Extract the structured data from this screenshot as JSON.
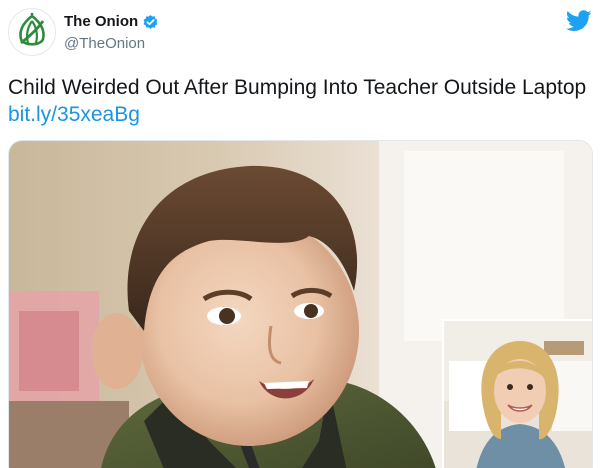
{
  "tweet": {
    "account": {
      "display_name": "The Onion",
      "handle": "@TheOnion",
      "verified": true,
      "avatar_icon": "onion-logo-icon"
    },
    "platform_icon": "twitter-bird-icon",
    "text": "Child Weirded Out After Bumping Into Teacher Outside Laptop",
    "link": "bit.ly/35xeaBg"
  },
  "colors": {
    "link": "#1b95e0",
    "verified": "#1da1f2",
    "twitter_brand": "#1da1f2",
    "onion_green": "#2e8b3e"
  },
  "media": {
    "description_main": "photo-boy",
    "description_inset": "photo-teacher-video-call"
  }
}
